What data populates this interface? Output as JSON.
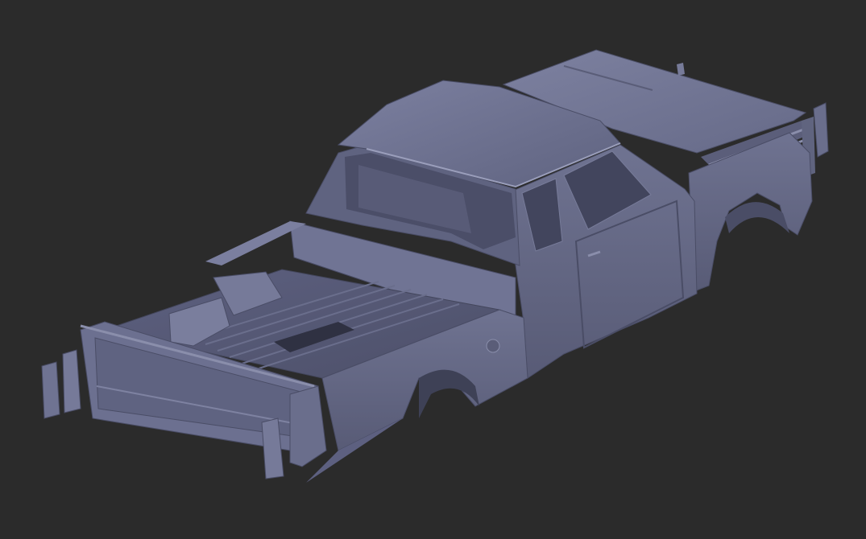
{
  "viewport": {
    "background_color": "#2b2b2b",
    "model_color": "#676b88",
    "model_highlight": "#8a8eab",
    "model_shadow": "#43465c",
    "subject": "truck-body-3d-model"
  }
}
